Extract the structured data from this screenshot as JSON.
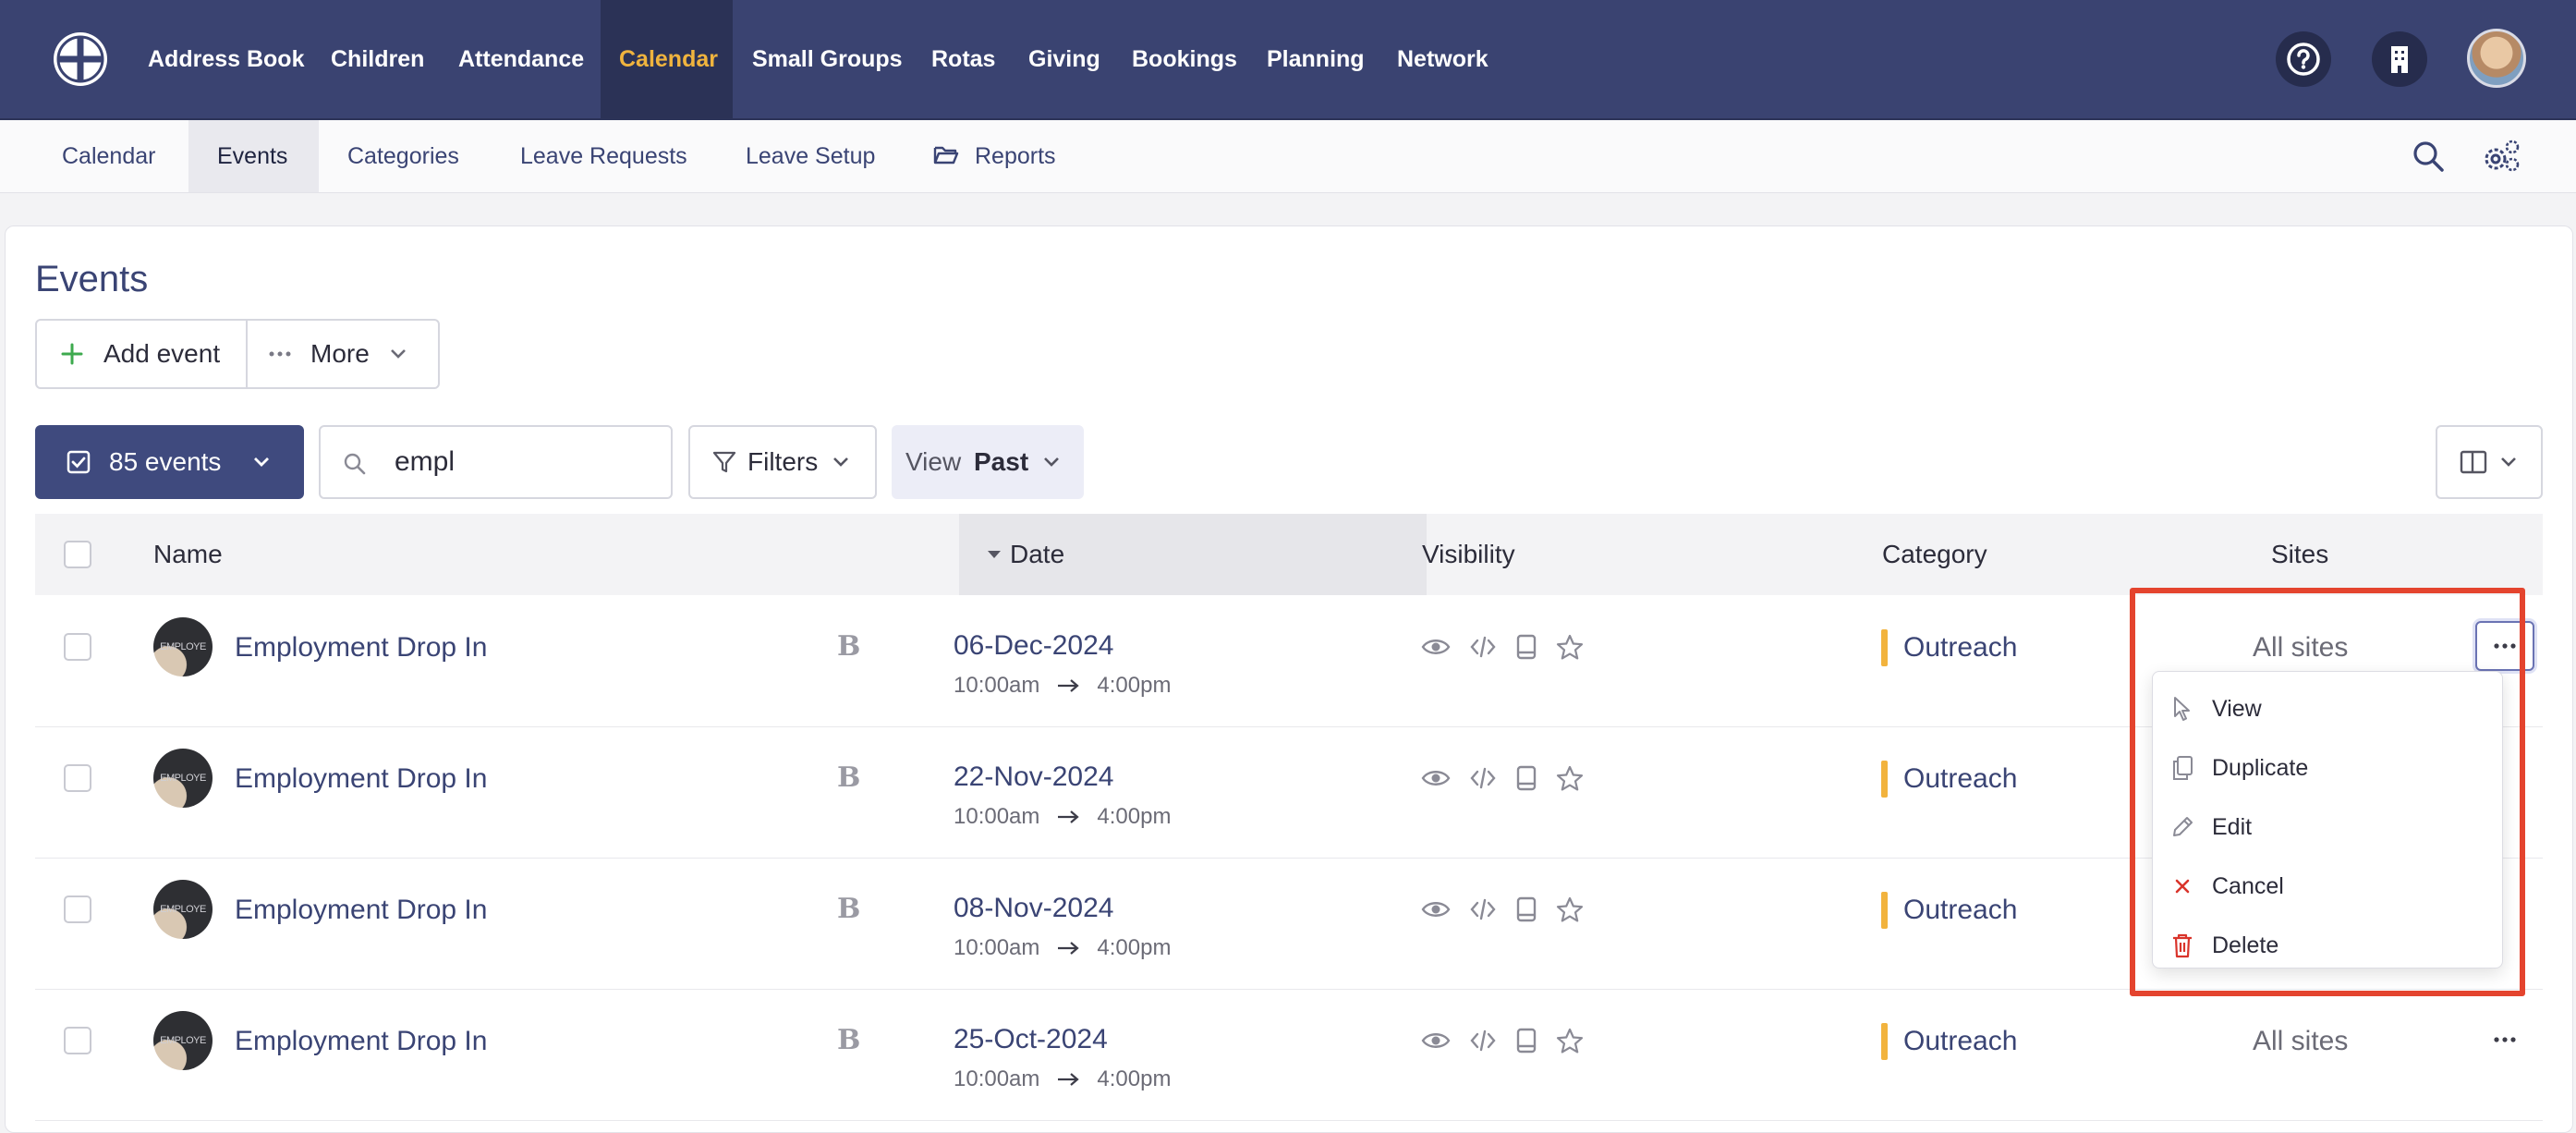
{
  "topnav": {
    "items": [
      "Address Book",
      "Children",
      "Attendance",
      "Calendar",
      "Small Groups",
      "Rotas",
      "Giving",
      "Bookings",
      "Planning",
      "Network"
    ],
    "active": "Calendar"
  },
  "subnav": {
    "items": [
      "Calendar",
      "Events",
      "Categories",
      "Leave Requests",
      "Leave Setup",
      "Reports"
    ],
    "active": "Events"
  },
  "page": {
    "title": "Events"
  },
  "toolbar": {
    "add_event": "Add event",
    "more": "More",
    "events_count": "85 events",
    "search_value": "empl",
    "filters": "Filters",
    "view_label": "View",
    "view_value": "Past"
  },
  "table": {
    "headers": {
      "name": "Name",
      "date": "Date",
      "visibility": "Visibility",
      "category": "Category",
      "sites": "Sites"
    },
    "rows": [
      {
        "name": "Employment Drop In",
        "thumb_text": "EMPLOYE",
        "badge": "B",
        "date": "06-Dec-2024",
        "start": "10:00am",
        "end": "4:00pm",
        "category": "Outreach",
        "sites": "All sites"
      },
      {
        "name": "Employment Drop In",
        "thumb_text": "EMPLOYE",
        "badge": "B",
        "date": "22-Nov-2024",
        "start": "10:00am",
        "end": "4:00pm",
        "category": "Outreach",
        "sites": ""
      },
      {
        "name": "Employment Drop In",
        "thumb_text": "EMPLOYE",
        "badge": "B",
        "date": "08-Nov-2024",
        "start": "10:00am",
        "end": "4:00pm",
        "category": "Outreach",
        "sites": ""
      },
      {
        "name": "Employment Drop In",
        "thumb_text": "EMPLOYE",
        "badge": "B",
        "date": "25-Oct-2024",
        "start": "10:00am",
        "end": "4:00pm",
        "category": "Outreach",
        "sites": "All sites"
      }
    ]
  },
  "row_menu": {
    "items": [
      {
        "label": "View",
        "icon": "cursor-icon"
      },
      {
        "label": "Duplicate",
        "icon": "copy-icon"
      },
      {
        "label": "Edit",
        "icon": "pencil-icon"
      },
      {
        "label": "Cancel",
        "icon": "x-icon"
      },
      {
        "label": "Delete",
        "icon": "trash-icon"
      }
    ]
  },
  "colors": {
    "nav_bg": "#3a4371",
    "nav_active_text": "#f0b43e",
    "link": "#3a4474",
    "category_bar": "#f2b33d",
    "highlight": "#e4442e",
    "danger": "#d9342b"
  }
}
